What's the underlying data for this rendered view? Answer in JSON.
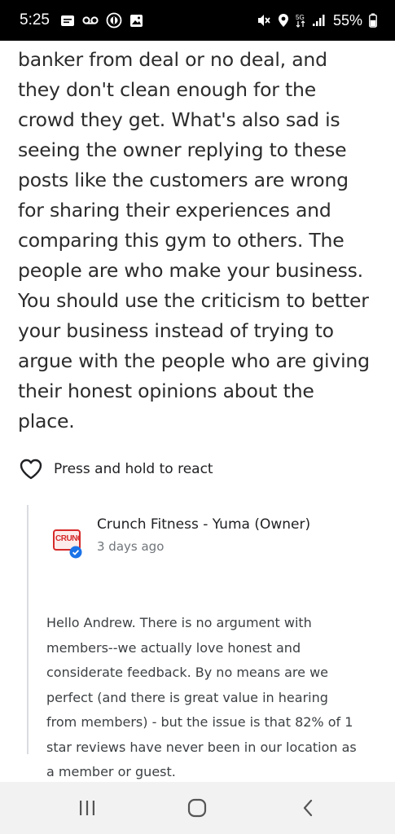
{
  "status_bar": {
    "time": "5:25",
    "battery_percent": "55%",
    "left_icons": [
      "message-icon",
      "voicemail-icon",
      "sync-icon",
      "image-icon"
    ],
    "right_icons": [
      "mute-icon",
      "location-icon",
      "data-icon",
      "signal-icon",
      "battery-icon"
    ]
  },
  "review": {
    "lines": [
      "banker from deal or no deal, and",
      "they don't clean enough for the",
      "crowd they get. What's also sad is",
      "seeing the owner replying to these",
      "posts like the customers are wrong",
      "for sharing their experiences and",
      "comparing this gym to others. The",
      "people are who make your business.",
      "You should use the criticism to better",
      "your business instead of trying to",
      "argue with the people who are giving",
      "their honest opinions about the",
      "place."
    ],
    "react_label": "Press and hold to react"
  },
  "owner_reply": {
    "name": "Crunch Fitness - Yuma (Owner)",
    "date": "3 days ago",
    "logo_text": "CRUNCH",
    "lines": [
      "Hello Andrew.  There is no argument with",
      "members--we actually love honest and",
      "considerate feedback.  By no means are we",
      "perfect (and there is great value in hearing",
      "from members) - but the issue is that 82% of 1",
      "star reviews have never been in our location as",
      "a member or guest."
    ]
  },
  "nav_bar": {
    "buttons": [
      "recents-button",
      "home-button",
      "back-button"
    ]
  }
}
